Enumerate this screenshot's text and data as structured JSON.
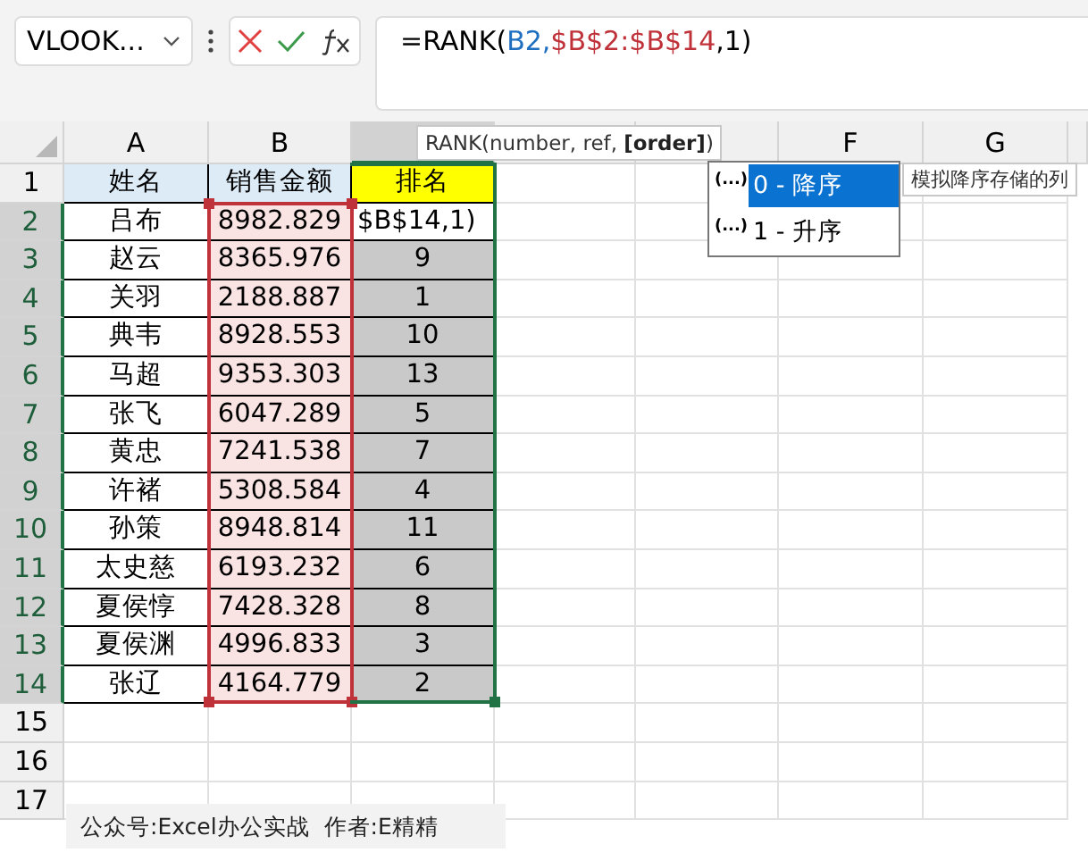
{
  "name_box": {
    "value": "VLOOK..."
  },
  "formula": [
    {
      "text": "=RANK(",
      "color": "#000000"
    },
    {
      "text": "B2,",
      "color": "#1f6fc0"
    },
    {
      "text": "$B$2:$B$14",
      "color": "#c0323a"
    },
    {
      "text": ",1)",
      "color": "#000000"
    }
  ],
  "columns": [
    {
      "label": "A",
      "selected": false
    },
    {
      "label": "B",
      "selected": false
    },
    {
      "selected": true
    },
    {
      "selected": false
    },
    {
      "selected": false
    },
    {
      "label": "F",
      "selected": false
    },
    {
      "label": "G",
      "selected": false
    }
  ],
  "header_row": {
    "number": "1",
    "cells": [
      "姓名",
      "销售金额",
      "排名"
    ]
  },
  "rows": [
    {
      "number": "2",
      "name": "吕布",
      "sales": "8982.829",
      "rank": "$B$14,1)",
      "editing": true
    },
    {
      "number": "3",
      "name": "赵云",
      "sales": "8365.976",
      "rank": "9",
      "editing": false
    },
    {
      "number": "4",
      "name": "关羽",
      "sales": "2188.887",
      "rank": "1",
      "editing": false
    },
    {
      "number": "5",
      "name": "典韦",
      "sales": "8928.553",
      "rank": "10",
      "editing": false
    },
    {
      "number": "6",
      "name": "马超",
      "sales": "9353.303",
      "rank": "13",
      "editing": false
    },
    {
      "number": "7",
      "name": "张飞",
      "sales": "6047.289",
      "rank": "5",
      "editing": false
    },
    {
      "number": "8",
      "name": "黄忠",
      "sales": "7241.538",
      "rank": "7",
      "editing": false
    },
    {
      "number": "9",
      "name": "许褚",
      "sales": "5308.584",
      "rank": "4",
      "editing": false
    },
    {
      "number": "10",
      "name": "孙策",
      "sales": "8948.814",
      "rank": "11",
      "editing": false
    },
    {
      "number": "11",
      "name": "太史慈",
      "sales": "6193.232",
      "rank": "6",
      "editing": false
    },
    {
      "number": "12",
      "name": "夏侯惇",
      "sales": "7428.328",
      "rank": "8",
      "editing": false
    },
    {
      "number": "13",
      "name": "夏侯渊",
      "sales": "4996.833",
      "rank": "3",
      "editing": false
    },
    {
      "number": "14",
      "name": "张辽",
      "sales": "4164.779",
      "rank": "2",
      "editing": false
    }
  ],
  "empty_rows": [
    "15",
    "16",
    "17"
  ],
  "footer_note": "公众号:Excel办公实战  作者:E精精",
  "tooltip": {
    "prefix": "RANK(number, ref, ",
    "bold": "[order]",
    "suffix": ")"
  },
  "autocomplete": [
    {
      "badge": "(...)",
      "label": "0 - 降序",
      "selected": true
    },
    {
      "badge": "(...)",
      "label": "1 - 升序",
      "selected": false
    }
  ],
  "autocomplete_hint": "模拟降序存储的列"
}
